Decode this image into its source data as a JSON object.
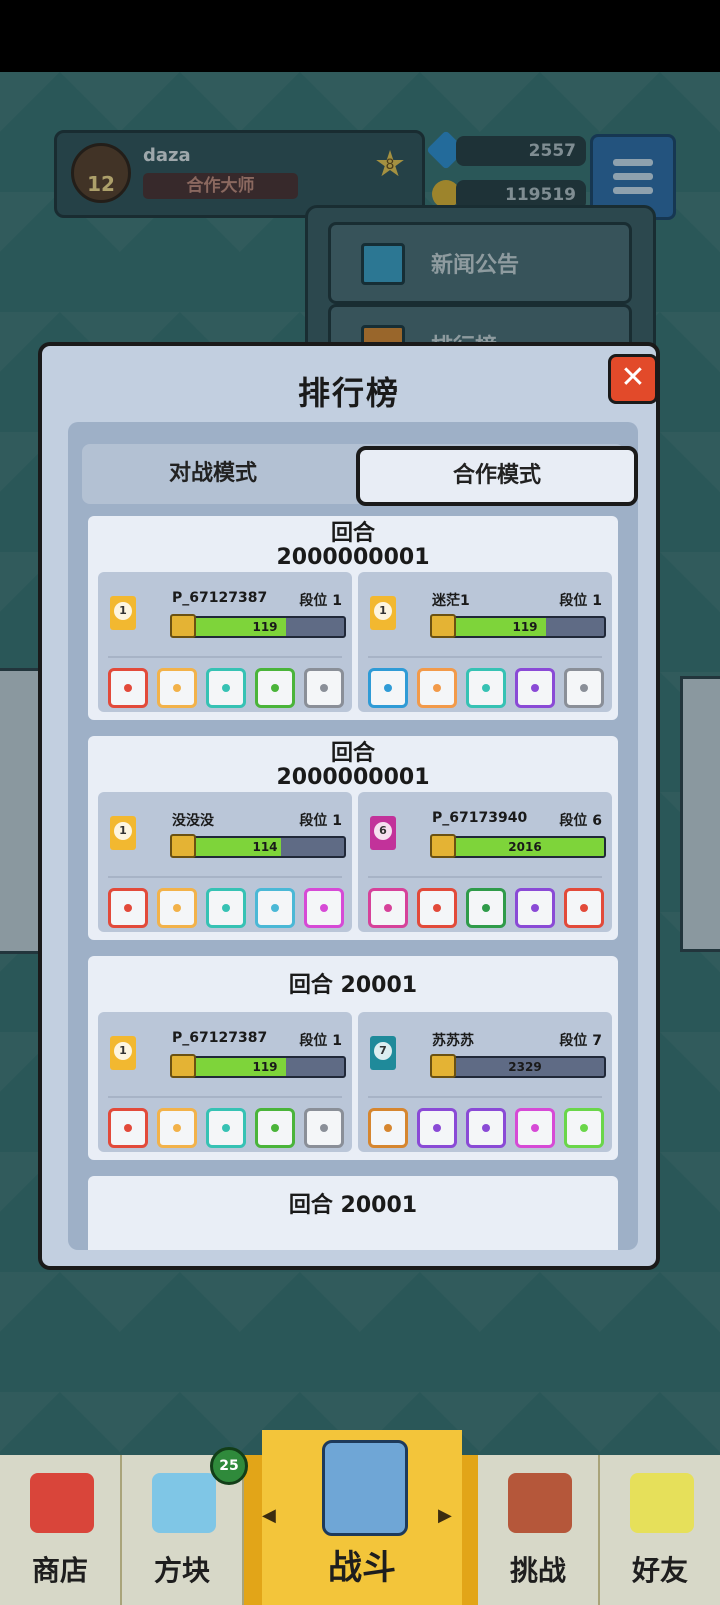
{
  "player": {
    "name": "daza",
    "level": "12",
    "title": "合作大师",
    "rank_badge": "8"
  },
  "currency": {
    "gems": "2557",
    "coins": "119519"
  },
  "dropdown": {
    "items": [
      {
        "label": "新闻公告"
      },
      {
        "label": "排行榜"
      }
    ]
  },
  "modal": {
    "title": "排行榜",
    "close_label": "✕",
    "tabs": [
      {
        "label": "对战模式",
        "active": false
      },
      {
        "label": "合作模式",
        "active": true
      }
    ],
    "entries": [
      {
        "round": "回合",
        "round_value": "2000000001",
        "players": [
          {
            "name": "P_67127387",
            "tier": "段位 1",
            "score": "119",
            "fill": 0.63,
            "medal_color": "#f2b830",
            "medal_num": "1",
            "dice": [
              "#e24a3a",
              "#f2b24a",
              "#36c2b4",
              "#4ab43a",
              "#8a8f98"
            ]
          },
          {
            "name": "迷茫1",
            "tier": "段位 1",
            "score": "119",
            "fill": 0.63,
            "medal_color": "#f2b830",
            "medal_num": "1",
            "dice": [
              "#2f9bd6",
              "#f29a4a",
              "#36c2b4",
              "#8a4ad6",
              "#8a8f98"
            ]
          }
        ]
      },
      {
        "round": "回合",
        "round_value": "2000000001",
        "players": [
          {
            "name": "没没没",
            "tier": "段位 1",
            "score": "114",
            "fill": 0.6,
            "medal_color": "#f2b830",
            "medal_num": "1",
            "dice": [
              "#e24a3a",
              "#f2b24a",
              "#36c2b4",
              "#4ab8d6",
              "#d64ad6"
            ]
          },
          {
            "name": "P_67173940",
            "tier": "段位 6",
            "score": "2016",
            "fill": 1.0,
            "medal_color": "#c2329a",
            "medal_num": "6",
            "dice": [
              "#d6429a",
              "#e24a3a",
              "#2f9b4a",
              "#8a4ad6",
              "#e24a3a"
            ]
          }
        ]
      },
      {
        "round": "回合 20001",
        "round_value": "",
        "players": [
          {
            "name": "P_67127387",
            "tier": "段位 1",
            "score": "119",
            "fill": 0.63,
            "medal_color": "#f2b830",
            "medal_num": "1",
            "dice": [
              "#e24a3a",
              "#f2b24a",
              "#36c2b4",
              "#4ab43a",
              "#8a8f98"
            ]
          },
          {
            "name": "苏苏苏",
            "tier": "段位 7",
            "score": "2329",
            "fill": 0.0,
            "medal_color": "#1f8a9a",
            "medal_num": "7",
            "dice": [
              "#d6862f",
              "#8a4ad6",
              "#8a4ad6",
              "#d64ad6",
              "#6ad64a"
            ]
          }
        ]
      },
      {
        "round": "回合 20001",
        "round_value": "",
        "players": []
      }
    ]
  },
  "nav": {
    "items": [
      {
        "label": "商店",
        "active": false
      },
      {
        "label": "方块",
        "active": false,
        "badge": "25"
      },
      {
        "label": "战斗",
        "active": true
      },
      {
        "label": "挑战",
        "active": false
      },
      {
        "label": "好友",
        "active": false
      }
    ]
  },
  "colors": {
    "accent_active_nav": "#f3c53a",
    "close_red": "#e24a2a",
    "bar_green": "#7ed43a"
  }
}
